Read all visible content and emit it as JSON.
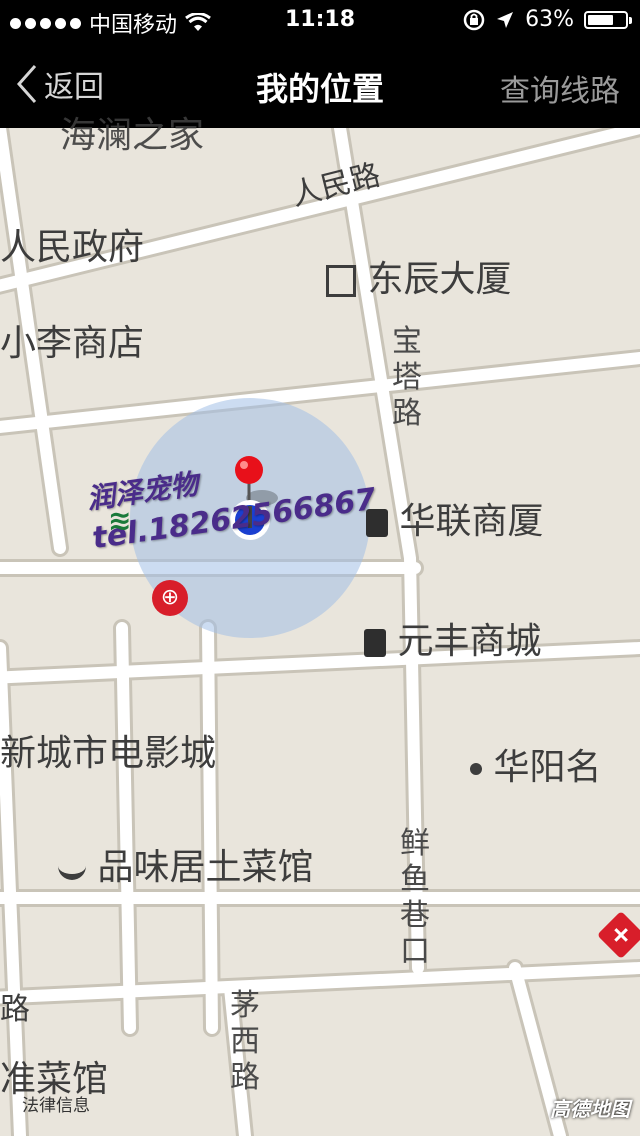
{
  "status_bar": {
    "carrier": "中国移动",
    "time": "11:18",
    "battery": "63%"
  },
  "nav": {
    "back_label": "返回",
    "title": "我的位置",
    "query_label": "查询线路"
  },
  "map": {
    "roads": {
      "renmin": "人民路",
      "baota": "宝塔路",
      "xianyu": "鲜鱼巷口",
      "maoxi": "茅西路",
      "bottom_left": "路"
    },
    "places": {
      "gov": "人民政府",
      "shop": "小李商店",
      "dongchen": "东辰大厦",
      "hualian": "华联商厦",
      "yuanfeng": "元丰商城",
      "cinema": "新城市电影城",
      "huayang": "华阳名",
      "restaurant": "品味居土菜馆",
      "bottom_restaurant": "准菜馆",
      "top_partial": "海澜之家"
    },
    "watermark": {
      "name": "润泽宠物",
      "tel": "tel.18262566867"
    }
  },
  "footer": {
    "legal": "法律信息",
    "brand": "高德地图"
  },
  "colors": {
    "map_bg": "#e9e5dc",
    "road": "#ffffff",
    "accuracy": "#a3bfe6",
    "location_dot": "#1a3fd0",
    "pin": "#e8101a"
  }
}
